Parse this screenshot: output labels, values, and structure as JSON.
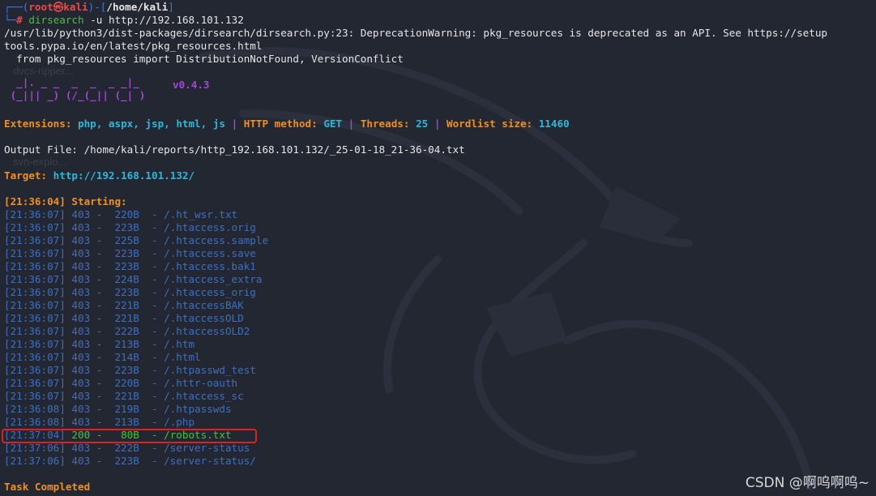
{
  "prompt": {
    "corner_top": "┌──(",
    "user": "root",
    "skull": "㉿",
    "host": "kali",
    "dir_open": ")-[",
    "dir": "/home/kali",
    "dir_close": "]",
    "corner_bottom": "└─",
    "hash": "#",
    "command": "dirsearch",
    "args": "-u",
    "url": "http://192.168.101.132"
  },
  "warning": {
    "line1": "/usr/lib/python3/dist-packages/dirsearch/dirsearch.py:23: DeprecationWarning: pkg_resources is deprecated as an API. See https://setup",
    "line2": "tools.pypa.io/en/latest/pkg_resources.html",
    "line3": "  from pkg_resources import DistributionNotFound, VersionConflict"
  },
  "banner": {
    "art1": "  _|. _ _  _  _  _ _|_ ",
    "art2": " (_||| _) (/_(_|| (_| ) ",
    "version": "v0.4.3"
  },
  "config": {
    "ext_label": "Extensions: ",
    "ext_value": "php, aspx, jsp, html, js",
    "sep": " | ",
    "method_label": "HTTP method: ",
    "method_value": "GET",
    "threads_label": "Threads: ",
    "threads_value": "25",
    "wordlist_label": "Wordlist size: ",
    "wordlist_value": "11460"
  },
  "output_file": "Output File: /home/kali/reports/http_192.168.101.132/_25-01-18_21-36-04.txt",
  "target": {
    "label": "Target: ",
    "url": "http://192.168.101.132/"
  },
  "starting": "[21:36:04] Starting:",
  "results": [
    "[21:36:07] 403 -  220B  - /.ht_wsr.txt",
    "[21:36:07] 403 -  223B  - /.htaccess.orig",
    "[21:36:07] 403 -  225B  - /.htaccess.sample",
    "[21:36:07] 403 -  223B  - /.htaccess.save",
    "[21:36:07] 403 -  223B  - /.htaccess.bak1",
    "[21:36:07] 403 -  224B  - /.htaccess_extra",
    "[21:36:07] 403 -  223B  - /.htaccess_orig",
    "[21:36:07] 403 -  221B  - /.htaccessBAK",
    "[21:36:07] 403 -  221B  - /.htaccessOLD",
    "[21:36:07] 403 -  222B  - /.htaccessOLD2",
    "[21:36:07] 403 -  213B  - /.htm",
    "[21:36:07] 403 -  214B  - /.html",
    "[21:36:07] 403 -  223B  - /.htpasswd_test",
    "[21:36:07] 403 -  220B  - /.httr-oauth",
    "[21:36:07] 403 -  221B  - /.htaccess_sc",
    "[21:36:08] 403 -  219B  - /.htpasswds",
    "[21:36:08] 403 -  213B  - /.php"
  ],
  "robots": {
    "time": "[21:37:04] ",
    "code": "200",
    "rest": " -   80B  - /robots.txt"
  },
  "results_after": [
    "[21:37:06] 403 -  222B  - /server-status",
    "[21:37:06] 403 -  223B  - /server-status/"
  ],
  "completed": "Task Completed",
  "ghost_icons": [
    "dvcs-ripper...",
    "svn-explo..."
  ],
  "watermark": "CSDN @啊呜啊呜~",
  "colors": {
    "background": "#232732",
    "prompt_blue": "#3b78e7",
    "root_red": "#ec4a4a",
    "accent_orange": "#f0901f",
    "accent_cyan": "#2eb7d9",
    "banner_purple": "#a347d6",
    "status_green": "#46c23a",
    "log_blue": "#3d6fc0",
    "highlight_red": "#e02020"
  }
}
